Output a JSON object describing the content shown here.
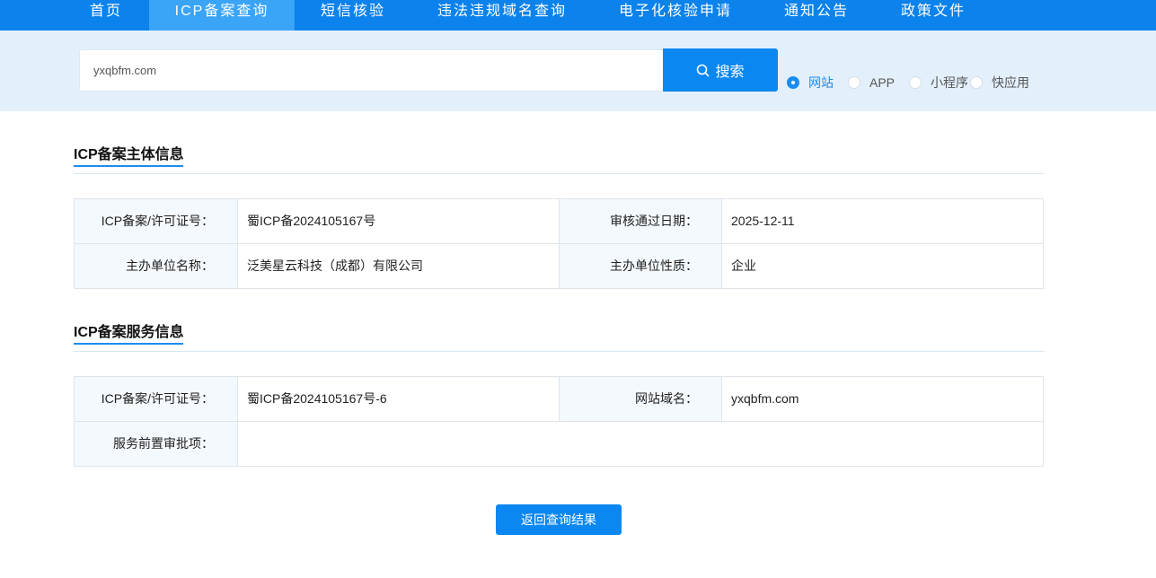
{
  "nav": {
    "items": [
      {
        "label": "首页"
      },
      {
        "label": "ICP备案查询"
      },
      {
        "label": "短信核验"
      },
      {
        "label": "违法违规域名查询"
      },
      {
        "label": "电子化核验申请"
      },
      {
        "label": "通知公告"
      },
      {
        "label": "政策文件"
      }
    ],
    "active": "ICP备案查询"
  },
  "search": {
    "value": "yxqbfm.com",
    "button_label": "搜索",
    "types": [
      {
        "label": "网站",
        "checked": true
      },
      {
        "label": "APP",
        "checked": false
      },
      {
        "label": "小程序",
        "checked": false
      },
      {
        "label": "快应用",
        "checked": false
      }
    ]
  },
  "subject": {
    "title": "ICP备案主体信息",
    "rows": [
      {
        "label1": "ICP备案/许可证号：",
        "value1": "蜀ICP备2024105167号",
        "label2": "审核通过日期：",
        "value2": "2025-12-11"
      },
      {
        "label1": "主办单位名称：",
        "value1": "泛美星云科技（成都）有限公司",
        "label2": "主办单位性质：",
        "value2": "企业"
      }
    ]
  },
  "service": {
    "title": "ICP备案服务信息",
    "row1": {
      "label1": "ICP备案/许可证号：",
      "value1": "蜀ICP备2024105167号-6",
      "label2": "网站域名：",
      "value2": "yxqbfm.com"
    },
    "row2": {
      "label": "服务前置审批项：",
      "value": ""
    }
  },
  "return_button": "返回查询结果",
  "colors": {
    "primary": "#0b82ec",
    "active_tab": "#3aa4f7",
    "band": "#e3f0fc",
    "label_bg": "#f4f9fd"
  }
}
